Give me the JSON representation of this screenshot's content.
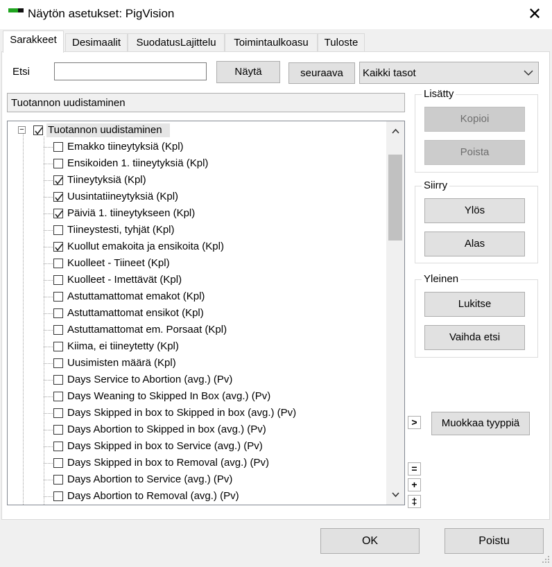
{
  "window": {
    "title": "Näytön asetukset: PigVision",
    "close_glyph": "✕",
    "icon": "app-icon"
  },
  "tabs": [
    {
      "label": "Sarakkeet",
      "active": true
    },
    {
      "label": "Desimaalit",
      "active": false
    },
    {
      "label": "SuodatusLajittelu",
      "active": false
    },
    {
      "label": "Toimintaulkoasu",
      "active": false
    },
    {
      "label": "Tuloste",
      "active": false
    }
  ],
  "search": {
    "label": "Etsi",
    "value": "",
    "show_button": "Näytä",
    "next_button": "seuraava",
    "level_select": "Kaikki tasot"
  },
  "selected_path": "Tuotannon uudistaminen",
  "tree": {
    "root": {
      "label": "Tuotannon uudistaminen",
      "checked": true,
      "expander": "⊟"
    },
    "items": [
      {
        "label": "Emakko tiineytyksiä (Kpl)",
        "checked": false
      },
      {
        "label": "Ensikoiden 1. tiineytyksiä (Kpl)",
        "checked": false
      },
      {
        "label": "Tiineytyksiä (Kpl)",
        "checked": true
      },
      {
        "label": "Uusintatiineytyksiä (Kpl)",
        "checked": true
      },
      {
        "label": "Päiviä 1. tiineytykseen (Kpl)",
        "checked": true
      },
      {
        "label": "Tiineystesti, tyhjät (Kpl)",
        "checked": false
      },
      {
        "label": "Kuollut emakoita ja ensikoita (Kpl)",
        "checked": true
      },
      {
        "label": "Kuolleet - Tiineet (Kpl)",
        "checked": false
      },
      {
        "label": "Kuolleet - Imettävät (Kpl)",
        "checked": false
      },
      {
        "label": "Astuttamattomat emakot (Kpl)",
        "checked": false
      },
      {
        "label": "Astuttamattomat ensikot (Kpl)",
        "checked": false
      },
      {
        "label": "Astuttamattomat em. Porsaat (Kpl)",
        "checked": false
      },
      {
        "label": "Kiima, ei tiineytetty (Kpl)",
        "checked": false
      },
      {
        "label": "Uusimisten määrä (Kpl)",
        "checked": false
      },
      {
        "label": "Days Service to Abortion (avg.) (Pv)",
        "checked": false
      },
      {
        "label": "Days Weaning to Skipped In Box (avg.) (Pv)",
        "checked": false
      },
      {
        "label": "Days Skipped in box to Skipped in box (avg.) (Pv)",
        "checked": false
      },
      {
        "label": "Days Abortion to Skipped in box (avg.) (Pv)",
        "checked": false
      },
      {
        "label": "Days Skipped in box to Service (avg.) (Pv)",
        "checked": false
      },
      {
        "label": "Days Skipped in box to Removal (avg.) (Pv)",
        "checked": false
      },
      {
        "label": "Days Abortion to Service (avg.) (Pv)",
        "checked": false
      },
      {
        "label": "Days Abortion to Removal (avg.) (Pv)",
        "checked": false
      }
    ]
  },
  "scroll": {
    "up_glyph": "^",
    "down_glyph": "v"
  },
  "groups": {
    "added": {
      "title": "Lisätty",
      "copy": "Kopioi",
      "delete": "Poista"
    },
    "move": {
      "title": "Siirry",
      "up": "Ylös",
      "down": "Alas"
    },
    "general": {
      "title": "Yleinen",
      "lock": "Lukitse",
      "change_search": "Vaihda etsi"
    }
  },
  "expand_glyph": ">",
  "edit_type_button": "Muokkaa tyyppiä",
  "small_buttons": {
    "equal": "=",
    "plus": "+",
    "both": "‡"
  },
  "footer": {
    "ok": "OK",
    "cancel": "Poistu"
  },
  "colors": {
    "check_green": "#1fa51f",
    "button_bg": "#e1e1e1",
    "disabled_bg": "#cccccc"
  }
}
